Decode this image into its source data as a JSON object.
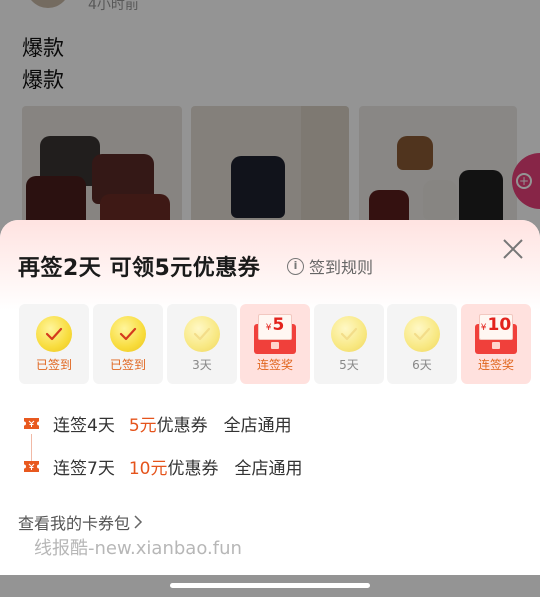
{
  "background": {
    "post_time": "4小时前",
    "post_lines": [
      "爆款",
      "爆款"
    ]
  },
  "sheet": {
    "title": "再签2天 可领5元优惠券",
    "rules_label": "签到规则",
    "days": [
      {
        "label": "已签到",
        "state": "done",
        "icon": "check-coin-icon"
      },
      {
        "label": "已签到",
        "state": "done",
        "icon": "check-coin-icon"
      },
      {
        "label": "3天",
        "state": "pending",
        "icon": "check-coin-icon"
      },
      {
        "label": "连签奖",
        "state": "reward",
        "currency": "¥",
        "amount": "5",
        "icon": "red-envelope-icon"
      },
      {
        "label": "5天",
        "state": "pending",
        "icon": "check-coin-icon"
      },
      {
        "label": "6天",
        "state": "pending",
        "icon": "check-coin-icon"
      },
      {
        "label": "连签奖",
        "state": "reward",
        "currency": "¥",
        "amount": "10",
        "icon": "red-envelope-icon"
      }
    ],
    "rewards": [
      {
        "streak": "连签4天",
        "amount": "5元",
        "type": "优惠券",
        "scope": "全店通用"
      },
      {
        "streak": "连签7天",
        "amount": "10元",
        "type": "优惠券",
        "scope": "全店通用"
      }
    ],
    "wallet_link": "查看我的卡券包",
    "watermark": "线报酷-new.xianbao.fun"
  },
  "colors": {
    "accent_orange": "#e5541c",
    "envelope_red": "#f0403b",
    "coin_gold": "#f8dc3c",
    "side_button_pink": "#e8417a"
  }
}
